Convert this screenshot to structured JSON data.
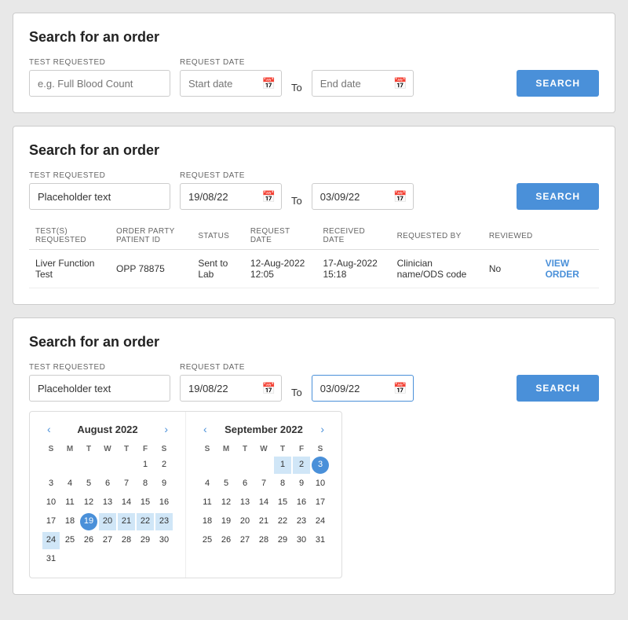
{
  "card1": {
    "title": "Search for an order",
    "test_label": "TEST REQUESTED",
    "test_placeholder": "e.g. Full Blood Count",
    "date_label": "REQUEST DATE",
    "start_placeholder": "Start date",
    "end_placeholder": "End date",
    "to_label": "To",
    "search_btn": "SEARCH"
  },
  "card2": {
    "title": "Search for an order",
    "test_label": "TEST REQUESTED",
    "test_value": "Placeholder text",
    "date_label": "REQUEST DATE",
    "start_value": "19/08/22",
    "end_value": "03/09/22",
    "to_label": "To",
    "search_btn": "SEARCH",
    "table": {
      "headers": [
        "TEST(S) REQUESTED",
        "ORDER PARTY PATIENT ID",
        "STATUS",
        "REQUEST DATE",
        "RECEIVED DATE",
        "REQUESTED BY",
        "REVIEWED",
        ""
      ],
      "rows": [
        {
          "test": "Liver Function Test",
          "patient_id": "OPP 78875",
          "status": "Sent to Lab",
          "request_date": "12-Aug-2022 12:05",
          "received_date": "17-Aug-2022 15:18",
          "requested_by": "Clinician name/ODS code",
          "reviewed": "No",
          "action": "VIEW ORDER"
        }
      ]
    }
  },
  "card3": {
    "title": "Search for an order",
    "test_label": "TEST REQUESTED",
    "test_value": "Placeholder text",
    "date_label": "REQUEST DATE",
    "start_value": "19/08/22",
    "end_value": "03/09/22",
    "to_label": "To",
    "search_btn": "searcH",
    "calendar": {
      "august": {
        "title": "August 2022",
        "day_headers": [
          "S",
          "M",
          "T",
          "W",
          "T",
          "F",
          "S"
        ],
        "weeks": [
          [
            "",
            "",
            "",
            "",
            "",
            "",
            ""
          ],
          [
            "",
            "1",
            "2",
            "3",
            "4",
            "5",
            "6"
          ],
          [
            "7",
            "8",
            "9",
            "10",
            "11",
            "12",
            "13"
          ],
          [
            "14",
            "15",
            "16",
            "17",
            "18",
            "19",
            "20"
          ],
          [
            "21",
            "22",
            "23",
            "24",
            "25",
            "26",
            "27"
          ],
          [
            "28",
            "29",
            "30",
            "31",
            "",
            "",
            ""
          ]
        ],
        "selected": "19",
        "range_start": "19",
        "range_end": "31"
      },
      "september": {
        "title": "September 2022",
        "day_headers": [
          "S",
          "M",
          "T",
          "W",
          "T",
          "F",
          "S"
        ],
        "weeks": [
          [
            "",
            "",
            "",
            "",
            "1",
            "2",
            "3"
          ],
          [
            "4",
            "5",
            "6",
            "7",
            "8",
            "9",
            "10"
          ],
          [
            "11",
            "12",
            "13",
            "14",
            "15",
            "16",
            "17"
          ],
          [
            "18",
            "19",
            "20",
            "21",
            "22",
            "23",
            "24"
          ],
          [
            "25",
            "26",
            "27",
            "28",
            "29",
            "30",
            "31"
          ]
        ],
        "selected": "3",
        "range_start": "1",
        "range_end": "3"
      }
    }
  },
  "icons": {
    "calendar": "📅",
    "prev": "‹",
    "next": "›"
  }
}
